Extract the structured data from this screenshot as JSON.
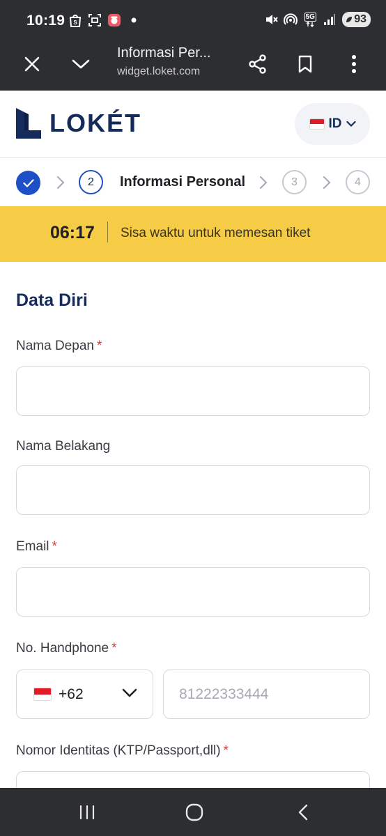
{
  "status_bar": {
    "time": "10:19",
    "left_icons": [
      "shopee-icon",
      "screenshot-icon",
      "app-notification-icon",
      "dot-icon"
    ],
    "right_icons": [
      "mute-icon",
      "hotspot-icon",
      "network-5g-icon",
      "signal-icon"
    ],
    "network_label": "5G",
    "battery": "93"
  },
  "browser": {
    "title": "Informasi Per...",
    "url": "widget.loket.com"
  },
  "header": {
    "logo_text": "LOKÉT",
    "language": "ID"
  },
  "stepper": {
    "steps": [
      {
        "number": "1",
        "state": "done"
      },
      {
        "number": "2",
        "state": "active",
        "label": "Informasi Personal"
      },
      {
        "number": "3",
        "state": "upcoming"
      },
      {
        "number": "4",
        "state": "upcoming"
      }
    ]
  },
  "timer": {
    "value": "06:17",
    "text": "Sisa waktu untuk memesan tiket"
  },
  "form": {
    "section_title": "Data Diri",
    "first_name": {
      "label": "Nama Depan",
      "required_mark": "*",
      "value": ""
    },
    "last_name": {
      "label": "Nama Belakang",
      "value": ""
    },
    "email": {
      "label": "Email",
      "required_mark": "*",
      "value": ""
    },
    "phone": {
      "label": "No. Handphone",
      "required_mark": "*",
      "country_code": "+62",
      "placeholder": "81222333444",
      "value": ""
    },
    "identity": {
      "label": "Nomor Identitas (KTP/Passport,dll)",
      "required_mark": "*"
    }
  },
  "colors": {
    "brand_navy": "#152c5b",
    "primary_blue": "#1d4fc6",
    "timer_yellow": "#f6cb45",
    "required_red": "#d93b36",
    "system_bar": "#2d2e31"
  }
}
